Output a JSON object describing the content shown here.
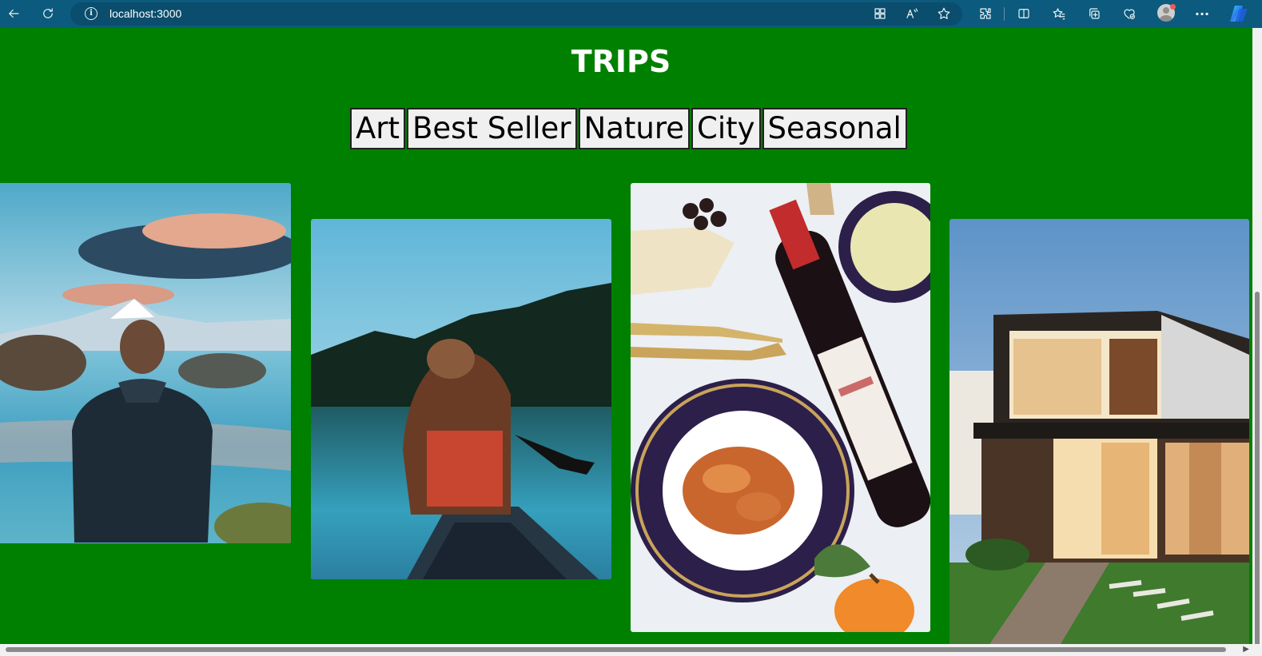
{
  "browser": {
    "url": "localhost:3000",
    "icons": {
      "back": "back-arrow-icon",
      "refresh": "refresh-icon",
      "info": "info-icon",
      "apps": "app-available-icon",
      "read_aloud": "read-aloud-icon",
      "favorite": "favorite-star-icon",
      "extensions": "extensions-icon",
      "split_screen": "split-screen-icon",
      "favorites": "favorites-icon",
      "collections": "collections-icon",
      "browser_essentials": "browser-essentials-icon",
      "profile": "profile-avatar",
      "more": "more-menu-icon",
      "copilot": "copilot-icon"
    },
    "info_glyph": "i",
    "more_glyph": "···"
  },
  "page": {
    "title": "TRIPS",
    "background_color": "#008000",
    "categories": [
      {
        "label": "Art"
      },
      {
        "label": "Best Seller"
      },
      {
        "label": "Nature"
      },
      {
        "label": "City"
      },
      {
        "label": "Seasonal"
      }
    ],
    "trip_cards": [
      {
        "subject": "man-by-mountain-lake-photo"
      },
      {
        "subject": "woman-in-canoe-on-lake-photo"
      },
      {
        "subject": "wine-and-pasta-table-photo"
      },
      {
        "subject": "modern-house-at-dusk-photo"
      }
    ]
  }
}
